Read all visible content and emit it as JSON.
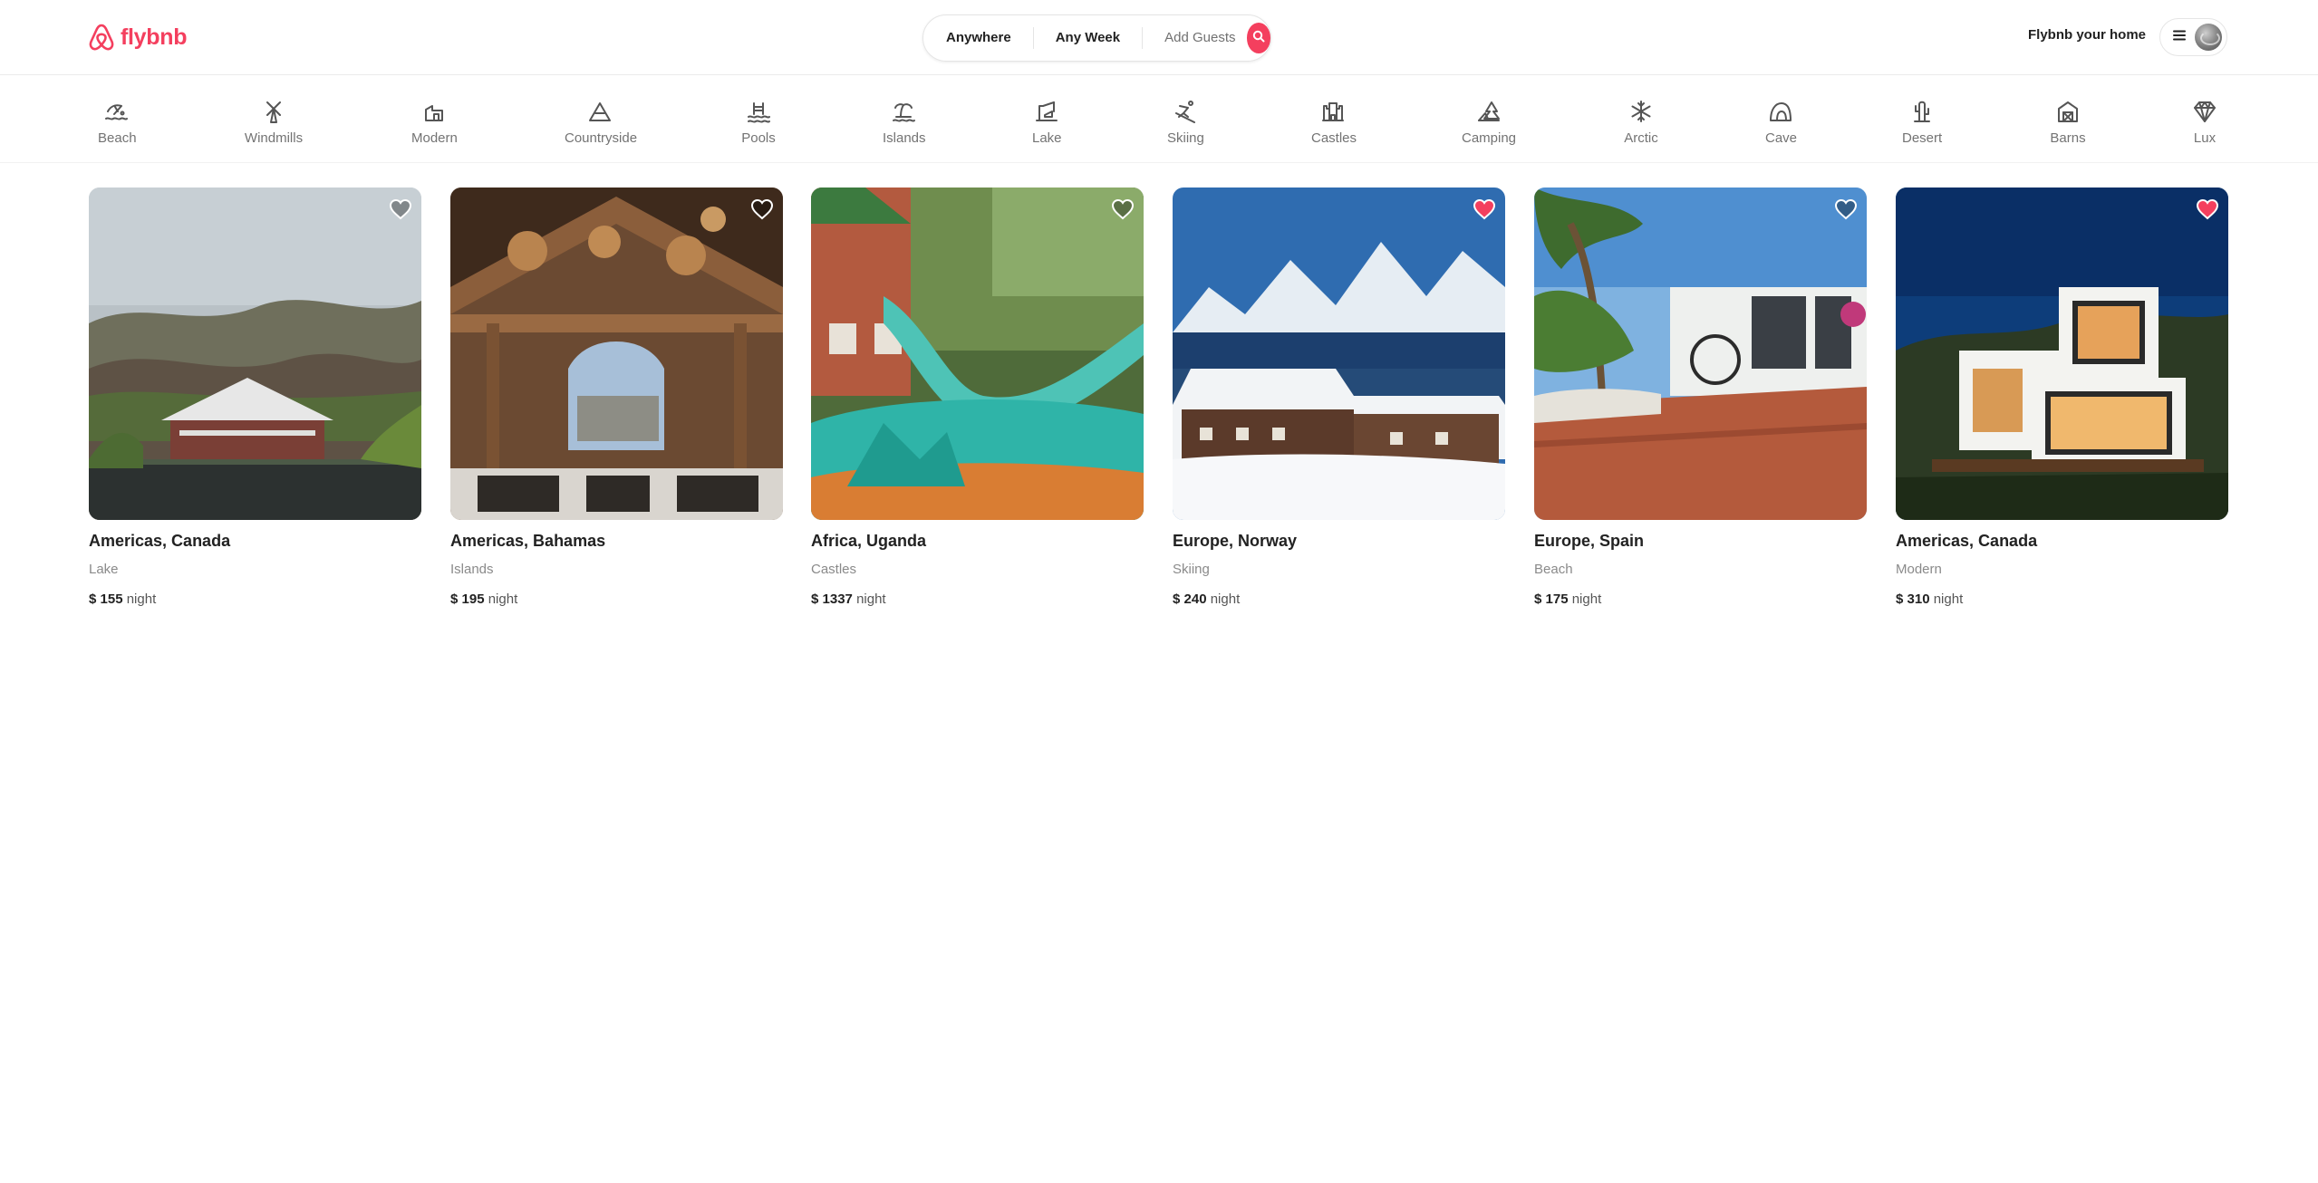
{
  "brand": {
    "name": "flybnb",
    "color": "#f43f5e"
  },
  "search": {
    "where": "Anywhere",
    "when": "Any Week",
    "who": "Add Guests",
    "icon": "search-icon"
  },
  "header": {
    "host_link": "Flybnb your home",
    "menu_icon": "hamburger-icon",
    "avatar": "avatar"
  },
  "categories": [
    {
      "label": "Beach",
      "icon": "beach-icon"
    },
    {
      "label": "Windmills",
      "icon": "windmill-icon"
    },
    {
      "label": "Modern",
      "icon": "modern-home-icon"
    },
    {
      "label": "Countryside",
      "icon": "mountain-icon"
    },
    {
      "label": "Pools",
      "icon": "pool-icon"
    },
    {
      "label": "Islands",
      "icon": "island-icon"
    },
    {
      "label": "Lake",
      "icon": "lake-icon"
    },
    {
      "label": "Skiing",
      "icon": "skiing-icon"
    },
    {
      "label": "Castles",
      "icon": "castle-icon"
    },
    {
      "label": "Camping",
      "icon": "camping-icon"
    },
    {
      "label": "Arctic",
      "icon": "snowflake-icon"
    },
    {
      "label": "Cave",
      "icon": "cave-icon"
    },
    {
      "label": "Desert",
      "icon": "cactus-icon"
    },
    {
      "label": "Barns",
      "icon": "barn-icon"
    },
    {
      "label": "Lux",
      "icon": "diamond-icon"
    }
  ],
  "listings": [
    {
      "location": "Americas, Canada",
      "category": "Lake",
      "currency": "$",
      "price": "155",
      "unit": "night",
      "favorited": false
    },
    {
      "location": "Americas, Bahamas",
      "category": "Islands",
      "currency": "$",
      "price": "195",
      "unit": "night",
      "favorited": false
    },
    {
      "location": "Africa, Uganda",
      "category": "Castles",
      "currency": "$",
      "price": "1337",
      "unit": "night",
      "favorited": false
    },
    {
      "location": "Europe, Norway",
      "category": "Skiing",
      "currency": "$",
      "price": "240",
      "unit": "night",
      "favorited": true
    },
    {
      "location": "Europe, Spain",
      "category": "Beach",
      "currency": "$",
      "price": "175",
      "unit": "night",
      "favorited": false
    },
    {
      "location": "Americas, Canada",
      "category": "Modern",
      "currency": "$",
      "price": "310",
      "unit": "night",
      "favorited": true
    }
  ],
  "colors": {
    "accent": "#f43f5e",
    "heart_active": "#f43f5e",
    "heart_inactive": "#ffffff",
    "muted_text": "#737373"
  }
}
